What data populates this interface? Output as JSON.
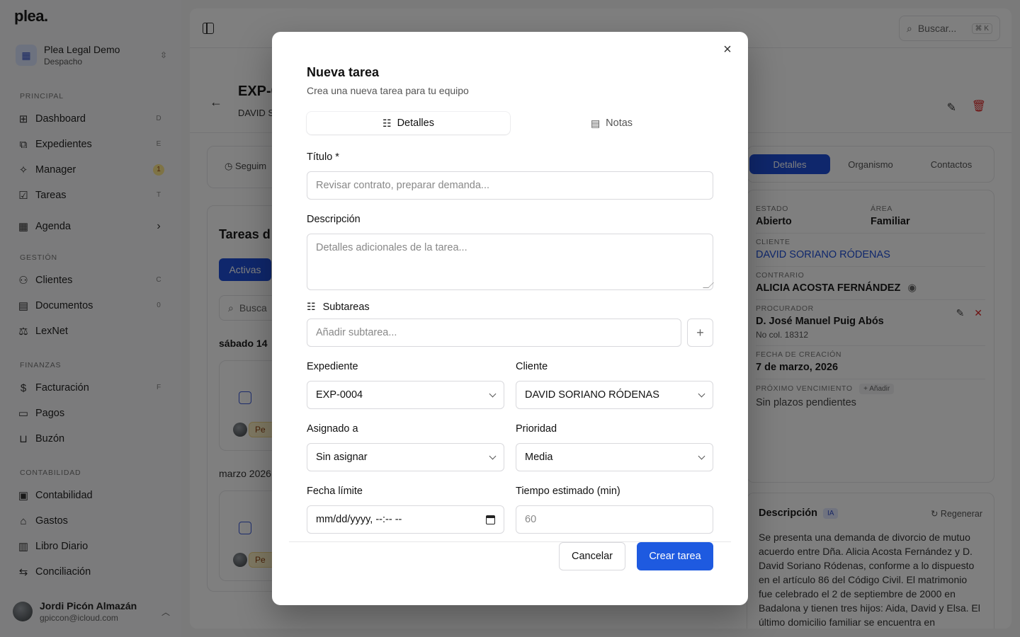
{
  "sidebar": {
    "logo": "plea.",
    "workspace": {
      "name": "Plea Legal Demo",
      "type": "Despacho"
    },
    "sections": [
      {
        "label": "PRINCIPAL"
      },
      {
        "label": "GESTIÓN"
      },
      {
        "label": "FINANZAS"
      },
      {
        "label": "CONTABILIDAD"
      }
    ],
    "items": [
      {
        "label": "Dashboard",
        "key": "D",
        "icon": "grid-icon"
      },
      {
        "label": "Expedientes",
        "key": "E",
        "icon": "folder-icon"
      },
      {
        "label": "Manager",
        "key": "1",
        "icon": "sparkle-icon"
      },
      {
        "label": "Tareas",
        "key": "T",
        "icon": "checkbox-icon"
      },
      {
        "label": "Agenda",
        "key": "›",
        "icon": "calendar-icon"
      },
      {
        "label": "Clientes",
        "key": "C",
        "icon": "users-icon"
      },
      {
        "label": "Documentos",
        "key": "0",
        "icon": "document-icon"
      },
      {
        "label": "LexNet",
        "key": "",
        "icon": "scale-icon"
      },
      {
        "label": "Facturación",
        "key": "F",
        "icon": "invoice-icon"
      },
      {
        "label": "Pagos",
        "key": "",
        "icon": "card-icon"
      },
      {
        "label": "Buzón",
        "key": "",
        "icon": "inbox-icon"
      },
      {
        "label": "Contabilidad",
        "key": "",
        "icon": "calculator-icon"
      },
      {
        "label": "Gastos",
        "key": "",
        "icon": "bank-icon"
      },
      {
        "label": "Libro Diario",
        "key": "",
        "icon": "book-icon"
      },
      {
        "label": "Conciliación",
        "key": "",
        "icon": "swap-icon"
      }
    ],
    "user": {
      "name": "Jordi Picón Almazán",
      "email": "gpiccon@icloud.com"
    }
  },
  "topbar": {
    "search_placeholder": "Buscar...",
    "shortcut": "⌘ K"
  },
  "page": {
    "title": "EXP-0",
    "subtitle": "DAVID S",
    "status_card": "Seguim",
    "tasks_title": "Tareas d",
    "active_filter": "Activas",
    "search_placeholder": "Busca",
    "date_group_1": "sábado 14",
    "date_group_2": "marzo 2026",
    "tag": "Pe"
  },
  "right_panel": {
    "tabs": [
      "Detalles",
      "Organismo",
      "Contactos"
    ],
    "estado_label": "ESTADO",
    "estado": "Abierto",
    "area_label": "ÁREA",
    "area": "Familiar",
    "cliente_label": "CLIENTE",
    "cliente": "DAVID SORIANO RÓDENAS",
    "contrario_label": "CONTRARIO",
    "contrario": "ALICIA ACOSTA FERNÁNDEZ",
    "procurador_label": "PROCURADOR",
    "procurador": "D. José Manuel Puig Abós",
    "procurador_col": "No col. 18312",
    "fecha_label": "FECHA DE CREACIÓN",
    "fecha": "7 de marzo, 2026",
    "vencimiento_label": "PRÓXIMO VENCIMIENTO",
    "vencimiento_add": "+ Añadir",
    "vencimiento": "Sin plazos pendientes",
    "desc_title": "Descripción",
    "desc_badge": "IA",
    "desc_regen": "Regenerar",
    "desc_body": "Se presenta una demanda de divorcio de mutuo acuerdo entre Dña. Alicia Acosta Fernández y D. David Soriano Ródenas, conforme a lo dispuesto en el artículo 86 del Código Civil. El matrimonio fue celebrado el 2 de septiembre de 2000 en Badalona y tienen tres hijos: Aida, David y Elsa. El último domicilio familiar se encuentra en"
  },
  "modal": {
    "title": "Nueva tarea",
    "subtitle": "Crea una nueva tarea para tu equipo",
    "tabs": [
      "Detalles",
      "Notas"
    ],
    "titulo_label": "Título *",
    "titulo_placeholder": "Revisar contrato, preparar demanda...",
    "descripcion_label": "Descripción",
    "descripcion_placeholder": "Detalles adicionales de la tarea...",
    "subtareas_label": "Subtareas",
    "subtarea_placeholder": "Añadir subtarea...",
    "expediente_label": "Expediente",
    "expediente_value": "EXP-0004",
    "cliente_label": "Cliente",
    "cliente_value": "DAVID SORIANO RÓDENAS",
    "asignado_label": "Asignado a",
    "asignado_value": "Sin asignar",
    "prioridad_label": "Prioridad",
    "prioridad_value": "Media",
    "fecha_label": "Fecha límite",
    "fecha_value": "mm/dd/yyyy, --:-- --",
    "tiempo_label": "Tiempo estimado (min)",
    "tiempo_placeholder": "60",
    "cancel": "Cancelar",
    "create": "Crear tarea"
  }
}
